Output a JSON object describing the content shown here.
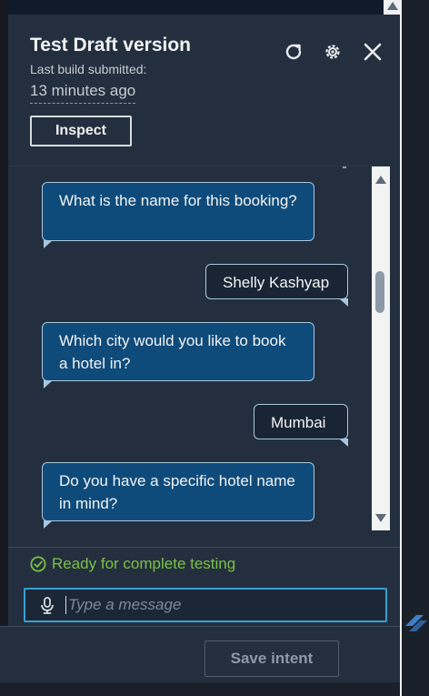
{
  "header": {
    "title": "Test Draft version",
    "subtitle": "Last build submitted:",
    "time": "13 minutes ago",
    "refresh_icon": "refresh-icon",
    "settings_icon": "gear-icon",
    "close_icon": "close-icon",
    "inspect_label": "Inspect"
  },
  "chat": {
    "messages": [
      {
        "role": "bot",
        "text": "What is the name for this booking?"
      },
      {
        "role": "user",
        "text": "Shelly Kashyap"
      },
      {
        "role": "bot",
        "text": "Which city would you like to book a hotel in?"
      },
      {
        "role": "user",
        "text": "Mumbai"
      },
      {
        "role": "bot",
        "text": "Do you have a specific hotel name in mind?"
      }
    ]
  },
  "status": {
    "text": "Ready for complete testing",
    "color": "#7bc144",
    "icon": "check-circle-icon"
  },
  "input": {
    "placeholder": "Type a message",
    "mic_icon": "microphone-icon"
  },
  "footer": {
    "save_label": "Save intent"
  },
  "colors": {
    "panel_bg": "#232f3e",
    "bot_bubble": "#0f4b7a",
    "user_bubble": "#192534",
    "input_border": "#39a0d5"
  }
}
